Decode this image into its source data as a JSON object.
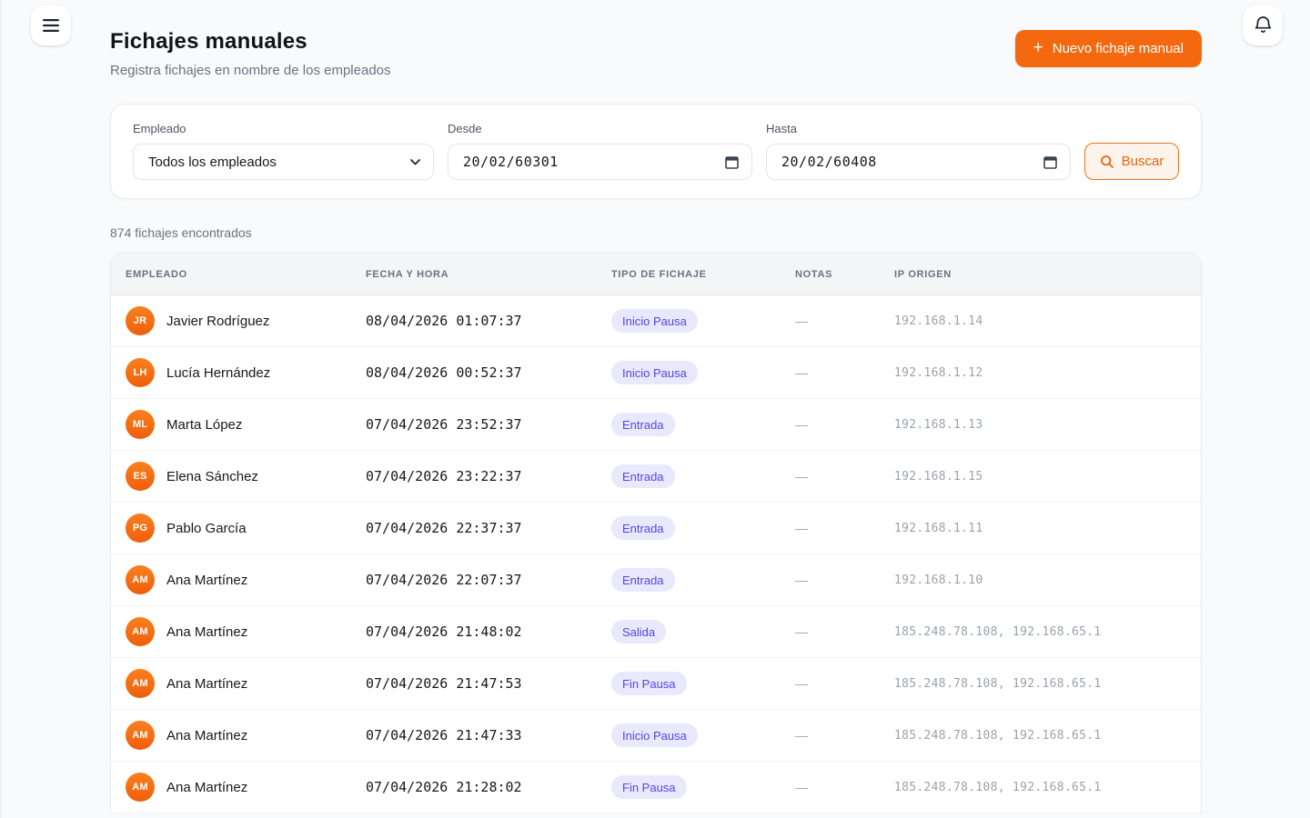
{
  "page": {
    "title": "Fichajes manuales",
    "subtitle": "Registra fichajes en nombre de los empleados",
    "new_entry_button": "Nuevo fichaje manual",
    "results_count": "874 fichajes encontrados"
  },
  "filters": {
    "employee": {
      "label": "Empleado",
      "value": "Todos los empleados"
    },
    "from": {
      "label": "Desde",
      "value": "20/02/60301"
    },
    "to": {
      "label": "Hasta",
      "value": "20/02/60408"
    },
    "search_button": "Buscar"
  },
  "icons": {
    "menu": "hamburger three-lines",
    "notifications": "bell outline",
    "new_entry": "+",
    "search": "magnifier",
    "calendar": "calendar glyph",
    "select_chevron": "chevron-down"
  },
  "colors": {
    "accent_orange": "#f4690f",
    "search_btn_bg": "#fef3ea",
    "badge_bg": "#e9e8fc",
    "badge_text": "#5347e8",
    "page_bg": "#f9fafb",
    "table_header_bg": "#f4f5f6",
    "muted_text": "#6b7280"
  },
  "table": {
    "columns": [
      "EMPLEADO",
      "FECHA Y HORA",
      "TIPO DE FICHAJE",
      "NOTAS",
      "IP ORIGEN"
    ],
    "rows": [
      {
        "initials": "JR",
        "name": "Javier Rodríguez",
        "datetime": "08/04/2026 01:07:37",
        "type": "Inicio Pausa",
        "notes": "—",
        "ip": "192.168.1.14"
      },
      {
        "initials": "LH",
        "name": "Lucía Hernández",
        "datetime": "08/04/2026 00:52:37",
        "type": "Inicio Pausa",
        "notes": "—",
        "ip": "192.168.1.12"
      },
      {
        "initials": "ML",
        "name": "Marta López",
        "datetime": "07/04/2026 23:52:37",
        "type": "Entrada",
        "notes": "—",
        "ip": "192.168.1.13"
      },
      {
        "initials": "ES",
        "name": "Elena Sánchez",
        "datetime": "07/04/2026 23:22:37",
        "type": "Entrada",
        "notes": "—",
        "ip": "192.168.1.15"
      },
      {
        "initials": "PG",
        "name": "Pablo García",
        "datetime": "07/04/2026 22:37:37",
        "type": "Entrada",
        "notes": "—",
        "ip": "192.168.1.11"
      },
      {
        "initials": "AM",
        "name": "Ana Martínez",
        "datetime": "07/04/2026 22:07:37",
        "type": "Entrada",
        "notes": "—",
        "ip": "192.168.1.10"
      },
      {
        "initials": "AM",
        "name": "Ana Martínez",
        "datetime": "07/04/2026 21:48:02",
        "type": "Salida",
        "notes": "—",
        "ip": "185.248.78.108, 192.168.65.1"
      },
      {
        "initials": "AM",
        "name": "Ana Martínez",
        "datetime": "07/04/2026 21:47:53",
        "type": "Fin Pausa",
        "notes": "—",
        "ip": "185.248.78.108, 192.168.65.1"
      },
      {
        "initials": "AM",
        "name": "Ana Martínez",
        "datetime": "07/04/2026 21:47:33",
        "type": "Inicio Pausa",
        "notes": "—",
        "ip": "185.248.78.108, 192.168.65.1"
      },
      {
        "initials": "AM",
        "name": "Ana Martínez",
        "datetime": "07/04/2026 21:28:02",
        "type": "Fin Pausa",
        "notes": "—",
        "ip": "185.248.78.108, 192.168.65.1"
      }
    ]
  }
}
